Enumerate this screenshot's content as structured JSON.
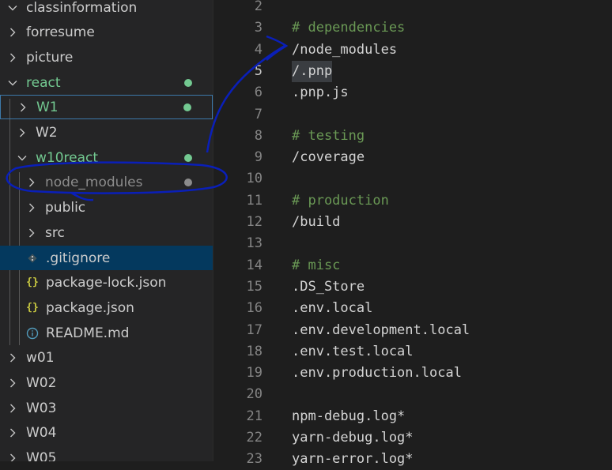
{
  "explorer": {
    "rows": [
      {
        "label": "classinformation",
        "expanded": true,
        "color": "#cccccc"
      },
      {
        "label": "forresume",
        "expanded": false,
        "color": "#cccccc"
      },
      {
        "label": "picture",
        "expanded": false,
        "color": "#cccccc"
      },
      {
        "label": "react",
        "expanded": true,
        "color": "#73c991",
        "modified": true
      },
      {
        "label": "W1",
        "expanded": false,
        "color": "#73c991",
        "modified": true,
        "focused": true
      },
      {
        "label": "W2",
        "expanded": false,
        "color": "#cccccc"
      },
      {
        "label": "w10react",
        "expanded": true,
        "color": "#73c991",
        "modified": true
      },
      {
        "label": "node_modules",
        "expanded": false,
        "color": "#8c8c8c",
        "ignored": true
      },
      {
        "label": "public",
        "expanded": false,
        "color": "#cccccc"
      },
      {
        "label": "src",
        "expanded": false,
        "color": "#cccccc"
      },
      {
        "label": ".gitignore",
        "icon": "git-icon",
        "color": "#cccccc",
        "selected": true
      },
      {
        "label": "package-lock.json",
        "icon": "json-braces-icon",
        "color": "#cccccc"
      },
      {
        "label": "package.json",
        "icon": "json-braces-icon",
        "color": "#cccccc"
      },
      {
        "label": "README.md",
        "icon": "info-icon",
        "color": "#cccccc"
      },
      {
        "label": "w01",
        "expanded": false,
        "color": "#cccccc"
      },
      {
        "label": "W02",
        "expanded": false,
        "color": "#cccccc"
      },
      {
        "label": "W03",
        "expanded": false,
        "color": "#cccccc"
      },
      {
        "label": "W04",
        "expanded": false,
        "color": "#cccccc"
      },
      {
        "label": "W05",
        "expanded": false,
        "color": "#cccccc"
      }
    ]
  },
  "editor": {
    "lines": [
      {
        "n": "2",
        "text": ""
      },
      {
        "n": "3",
        "text": "# dependencies",
        "kind": "comment"
      },
      {
        "n": "4",
        "text": "/node_modules"
      },
      {
        "n": "5",
        "text": "/.pnp",
        "active": true
      },
      {
        "n": "6",
        "text": ".pnp.js"
      },
      {
        "n": "7",
        "text": ""
      },
      {
        "n": "8",
        "text": "# testing",
        "kind": "comment"
      },
      {
        "n": "9",
        "text": "/coverage"
      },
      {
        "n": "10",
        "text": ""
      },
      {
        "n": "11",
        "text": "# production",
        "kind": "comment"
      },
      {
        "n": "12",
        "text": "/build"
      },
      {
        "n": "13",
        "text": ""
      },
      {
        "n": "14",
        "text": "# misc",
        "kind": "comment"
      },
      {
        "n": "15",
        "text": ".DS_Store"
      },
      {
        "n": "16",
        "text": ".env.local"
      },
      {
        "n": "17",
        "text": ".env.development.local"
      },
      {
        "n": "18",
        "text": ".env.test.local"
      },
      {
        "n": "19",
        "text": ".env.production.local"
      },
      {
        "n": "20",
        "text": ""
      },
      {
        "n": "21",
        "text": "npm-debug.log*"
      },
      {
        "n": "22",
        "text": "yarn-debug.log*"
      },
      {
        "n": "23",
        "text": "yarn-error.log*"
      }
    ]
  },
  "colors": {
    "git_modified": "#73c991",
    "git_ignored": "#8c8c8c",
    "comment": "#6a9955",
    "selection": "#04395e",
    "annotation_ink": "#0a1fb8"
  }
}
